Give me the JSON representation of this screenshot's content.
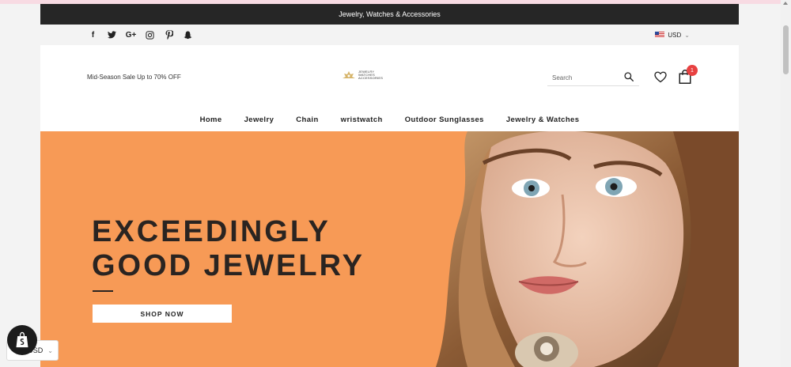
{
  "announcement": "Jewelry, Watches & Accessories",
  "social_icons": [
    "facebook-icon",
    "twitter-icon",
    "google-plus-icon",
    "instagram-icon",
    "pinterest-icon",
    "snapchat-icon"
  ],
  "social_labels": [
    "f",
    "G+"
  ],
  "currency": {
    "code": "USD"
  },
  "header": {
    "promo": "Mid-Season Sale Up to 70% OFF",
    "logo_lines": [
      "JEWELRY",
      "WATCHES",
      "ACCESSORIES"
    ],
    "search_placeholder": "Search",
    "cart_count": "1"
  },
  "nav": [
    "Home",
    "Jewelry",
    "Chain",
    "wristwatch",
    "Outdoor Sunglasses",
    "Jewelry & Watches"
  ],
  "hero": {
    "headline_1": "EXCEEDINGLY",
    "headline_2": "GOOD JEWELRY",
    "cta": "SHOP NOW"
  },
  "currency_popup": {
    "code": "USD"
  },
  "colors": {
    "announce_bg": "#262626",
    "hero_bg": "#f79a56",
    "badge": "#e84141",
    "text_dark": "#2a2421"
  }
}
